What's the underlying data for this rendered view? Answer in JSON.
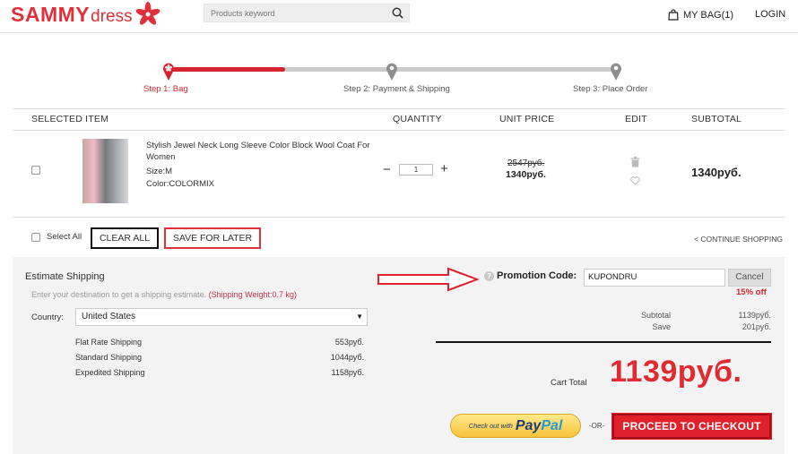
{
  "header": {
    "logo_main": "SAMMY",
    "logo_sub": "dress",
    "search_placeholder": "Products keyword",
    "bag_label": "MY BAG(1)",
    "login_label": "LOGIN"
  },
  "steps": [
    {
      "label": "Step 1: Bag",
      "active": true
    },
    {
      "label": "Step 2: Payment & Shipping",
      "active": false
    },
    {
      "label": "Step 3: Place Order",
      "active": false
    }
  ],
  "table": {
    "headers": {
      "item": "SELECTED ITEM",
      "quantity": "QUANTITY",
      "unit_price": "UNIT PRICE",
      "edit": "EDIT",
      "subtotal": "SUBTOTAL"
    },
    "row": {
      "name": "Stylish Jewel Neck Long Sleeve Color Block Wool Coat For Women",
      "size": "Size:M",
      "color": "Color:COLORMIX",
      "quantity": "1",
      "old_price": "2547руб.",
      "unit_price": "1340руб.",
      "subtotal": "1340руб."
    }
  },
  "actions": {
    "select_all": "Select All",
    "clear_all": "CLEAR ALL",
    "save_for_later": "SAVE FOR LATER",
    "continue_shopping": "< CONTINUE SHOPPING"
  },
  "shipping": {
    "title": "Estimate Shipping",
    "desc": "Enter your destination to get a shipping estimate.",
    "weight": "(Shipping Weight:0.7 kg)",
    "country_label": "Country:",
    "country_value": "United States",
    "methods": [
      {
        "name": "Flat Rate Shipping",
        "price": "553руб."
      },
      {
        "name": "Standard Shipping",
        "price": "1044руб."
      },
      {
        "name": "Expedited Shipping",
        "price": "1158руб."
      }
    ]
  },
  "promo": {
    "label": "Promotion Code:",
    "code": "KUPONDRU",
    "cancel": "Cancel",
    "discount": "15% off"
  },
  "summary": {
    "subtotal_label": "Subtotal",
    "subtotal_value": "1139руб.",
    "save_label": "Save",
    "save_value": "201руб.",
    "cart_total_label": "Cart Total",
    "cart_total_value": "1139руб."
  },
  "checkout": {
    "paypal_small": "Check out with",
    "paypal_a": "Pay",
    "paypal_b": "Pal",
    "or": "-OR-",
    "proceed": "PROCEED TO CHECKOUT"
  },
  "colors": {
    "brand_red": "#e0313a",
    "grey_panel": "#f3f3f3"
  }
}
